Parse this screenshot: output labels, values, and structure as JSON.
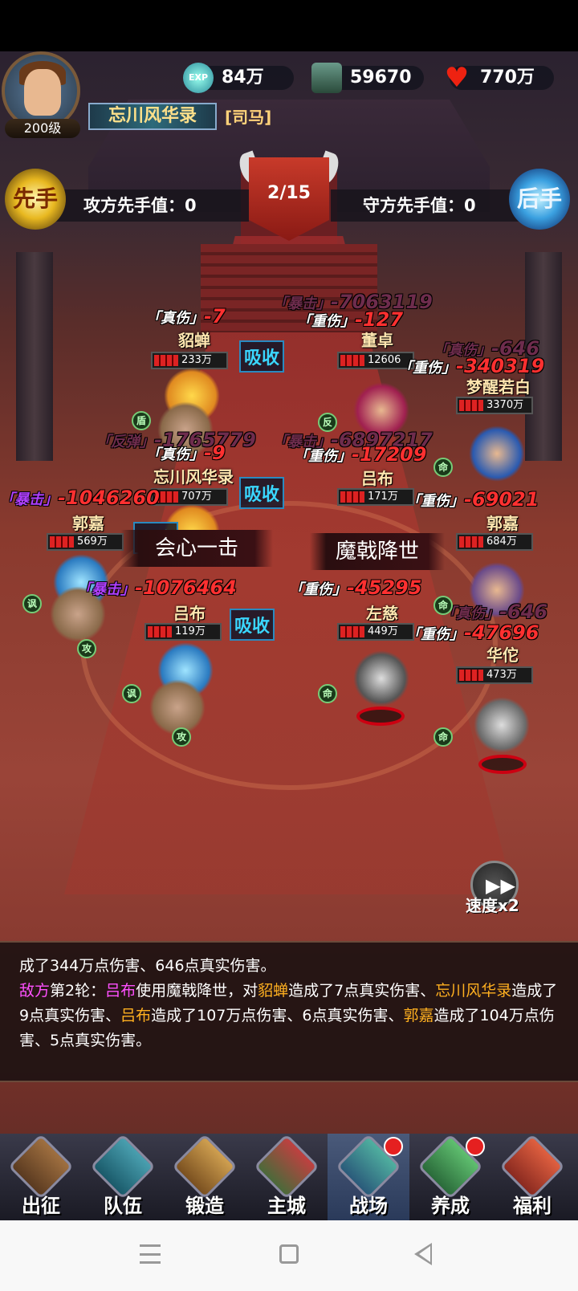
{
  "player": {
    "level": "200级",
    "name": "忘川风华录",
    "tag": "[司马]"
  },
  "resources": {
    "exp": {
      "icon": "exp-orb-icon",
      "icon_text": "EXP",
      "value": "84万"
    },
    "jade": {
      "icon": "jade-ticket-icon",
      "value": "59670"
    },
    "heart": {
      "icon": "heart-icon",
      "value": "770万"
    }
  },
  "battle": {
    "first_badge": "先手",
    "second_badge": "后手",
    "attacker_label": "攻方先手值：0",
    "defender_label": "守方先手值：0",
    "round": "2/15"
  },
  "units_left": [
    {
      "name": "貂蝉",
      "hp": "233万"
    },
    {
      "name": "忘川风华录",
      "hp": "707万"
    },
    {
      "name": "郭嘉",
      "hp": "569万"
    },
    {
      "name": "吕布",
      "hp": "119万"
    }
  ],
  "units_right": [
    {
      "name": "董卓",
      "hp": "12606"
    },
    {
      "name": "梦醒若白",
      "hp": "3370万"
    },
    {
      "name": "吕布",
      "hp": "171万"
    },
    {
      "name": "郭嘉",
      "hp": "684万"
    },
    {
      "name": "左慈",
      "hp": "449万"
    },
    {
      "name": "华佗",
      "hp": "473万"
    }
  ],
  "damage_texts": {
    "zhenshang": "「真伤」",
    "zhongshang": "「重伤」",
    "baoji": "「暴击」",
    "fantan": "「反弹」",
    "d1": "-7",
    "d2": "-127",
    "d3": "-7063119",
    "d4": "-646",
    "d5": "-340319",
    "d6": "-1765779",
    "d7": "-6897217",
    "d8": "-9",
    "d9": "-17209",
    "d10": "-1046260",
    "d11": "-69021",
    "d12": "-1076464",
    "d13": "-45295",
    "d14": "-47696",
    "d15": "-646"
  },
  "absorb_label": "吸收",
  "skills": {
    "left": "会心一击",
    "right": "魔戟降世"
  },
  "status_icons": {
    "hit": "命",
    "counter": "反",
    "shield": "盾",
    "mock": "讽",
    "attack": "攻"
  },
  "speed": {
    "label": "速度x2"
  },
  "log": {
    "line1": "成了344万点伤害、646点真实伤害。",
    "side": "敌方",
    "round": "第2轮：",
    "actor": "吕布",
    "use": "使用魔戟降世，对",
    "t1": "貂蝉",
    "r1": "造成了7点真实伤害、",
    "t2": "忘川风华录",
    "r2": "造成了9点真实伤害、",
    "t3": "吕布",
    "r3": "造成了107万点伤害、6点真实伤害、",
    "t4": "郭嘉",
    "r4": "造成了104万点伤害、5点真实伤害。"
  },
  "nav": [
    {
      "label": "出征",
      "icon": "crossed-swords-icon",
      "badge": false,
      "active": false
    },
    {
      "label": "队伍",
      "icon": "warrior-helmet-icon",
      "badge": false,
      "active": false
    },
    {
      "label": "锻造",
      "icon": "anvil-hammer-icon",
      "badge": false,
      "active": false
    },
    {
      "label": "主城",
      "icon": "castle-icon",
      "badge": false,
      "active": false
    },
    {
      "label": "战场",
      "icon": "battlefield-shield-icon",
      "badge": true,
      "active": true
    },
    {
      "label": "养成",
      "icon": "pagoda-icon",
      "badge": true,
      "active": false
    },
    {
      "label": "福利",
      "icon": "gift-temple-icon",
      "badge": false,
      "active": false
    }
  ],
  "colors": {
    "accent_red": "#ff3030",
    "absorb": "#3ad6ff",
    "log_enemy": "#ff50ff",
    "log_ally": "#ffb020"
  }
}
